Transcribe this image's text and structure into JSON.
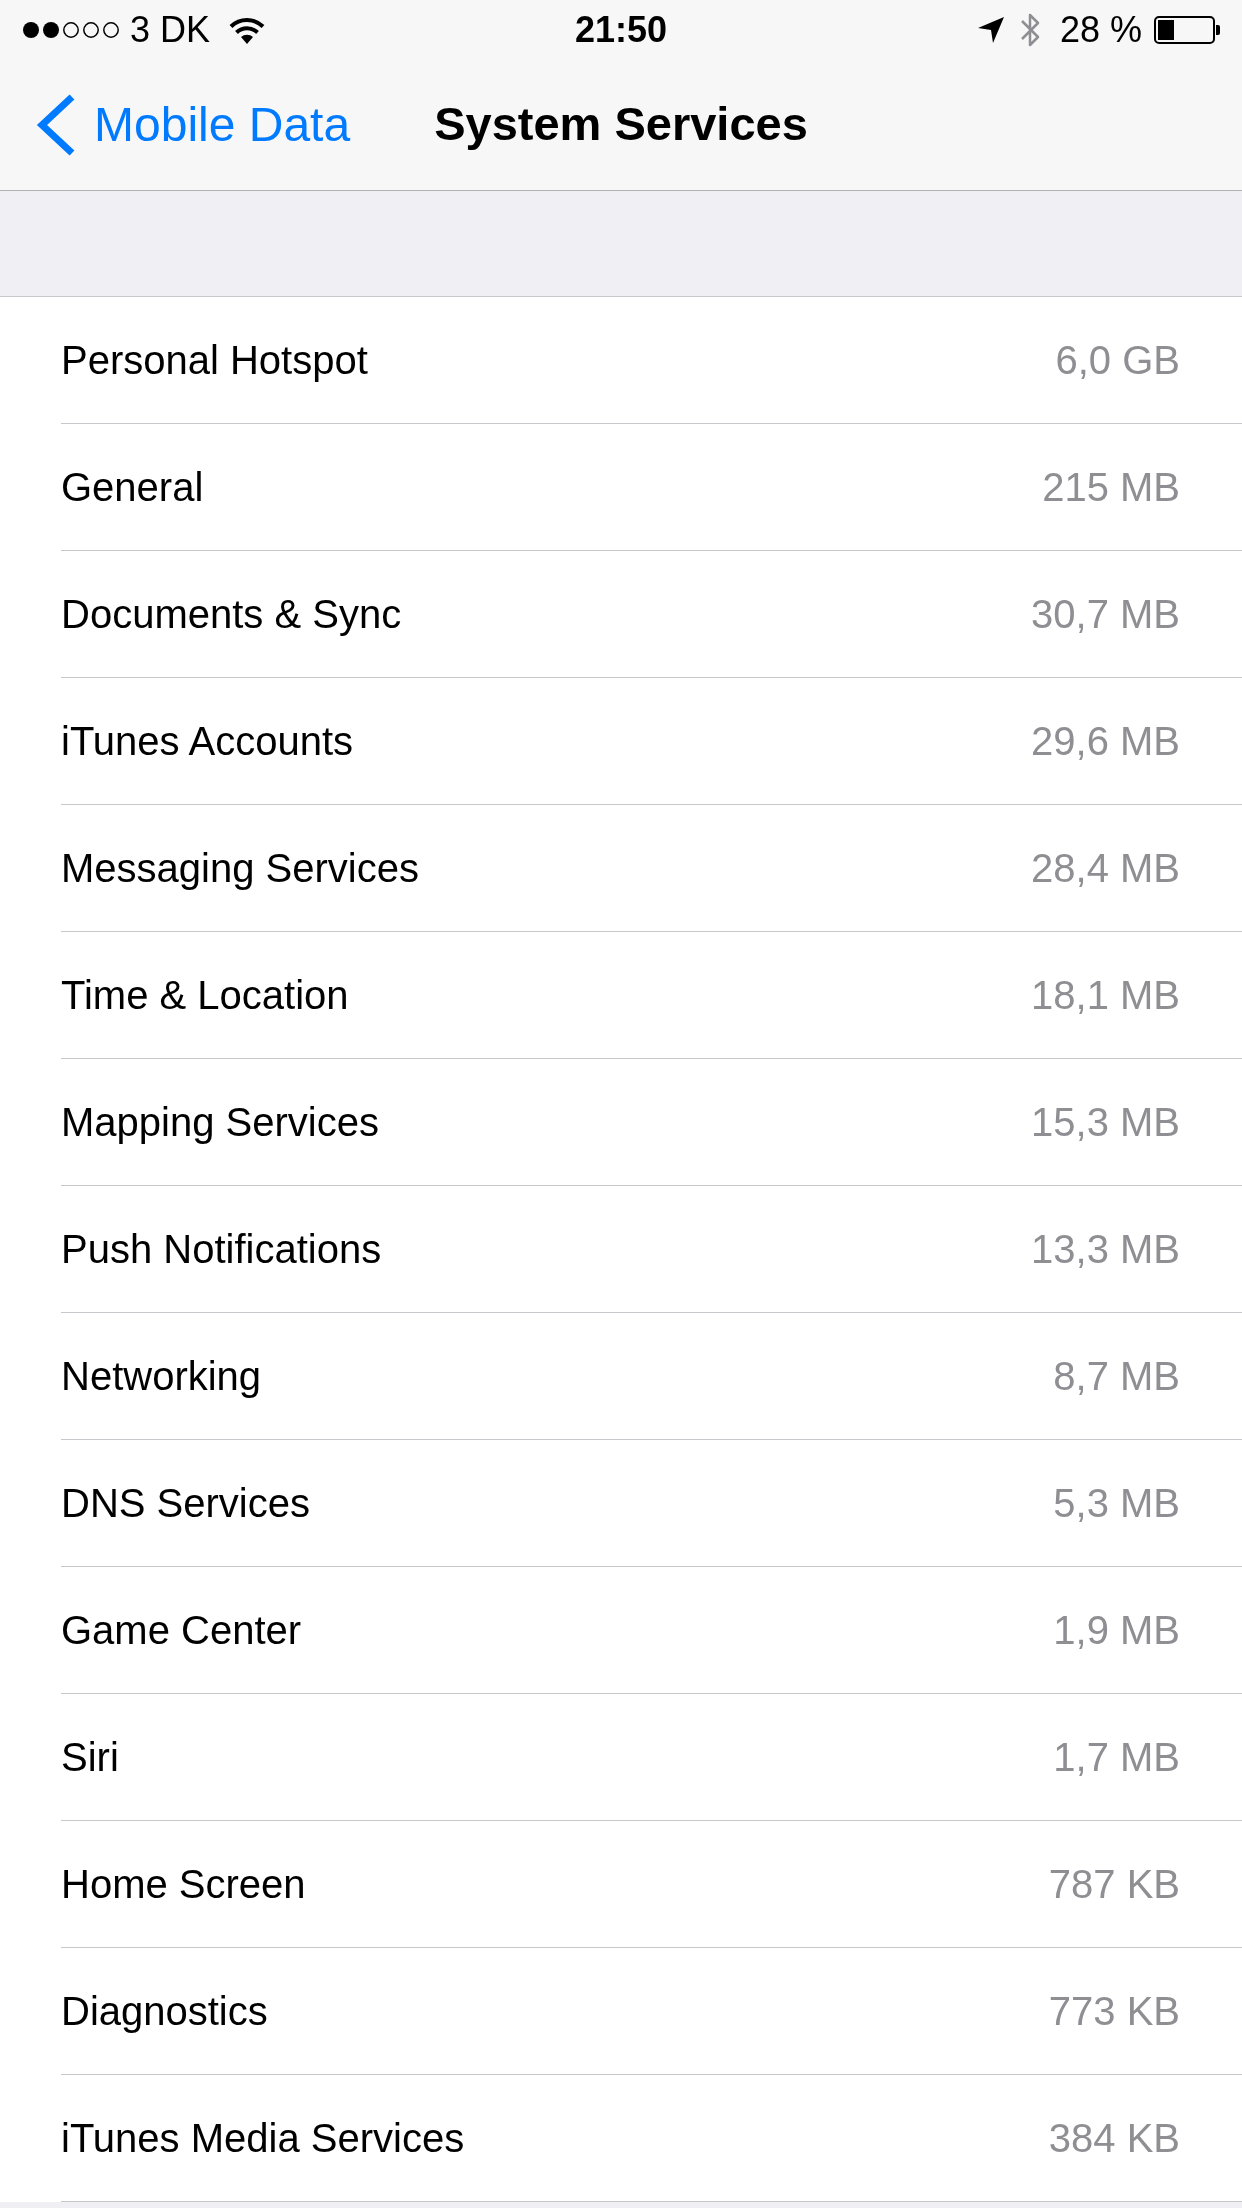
{
  "status_bar": {
    "carrier": "3 DK",
    "time": "21:50",
    "battery": "28 %"
  },
  "navigation_bar": {
    "back_label": "Mobile Data",
    "title": "System Services"
  },
  "rows": [
    {
      "label": "Personal Hotspot",
      "value": "6,0 GB"
    },
    {
      "label": "General",
      "value": "215 MB"
    },
    {
      "label": "Documents & Sync",
      "value": "30,7 MB"
    },
    {
      "label": "iTunes Accounts",
      "value": "29,6 MB"
    },
    {
      "label": "Messaging Services",
      "value": "28,4 MB"
    },
    {
      "label": "Time & Location",
      "value": "18,1 MB"
    },
    {
      "label": "Mapping Services",
      "value": "15,3 MB"
    },
    {
      "label": "Push Notifications",
      "value": "13,3 MB"
    },
    {
      "label": "Networking",
      "value": "8,7 MB"
    },
    {
      "label": "DNS Services",
      "value": "5,3 MB"
    },
    {
      "label": "Game Center",
      "value": "1,9 MB"
    },
    {
      "label": "Siri",
      "value": "1,7 MB"
    },
    {
      "label": "Home Screen",
      "value": "787 KB"
    },
    {
      "label": "Diagnostics",
      "value": "773 KB"
    },
    {
      "label": "iTunes Media Services",
      "value": "384 KB"
    }
  ]
}
